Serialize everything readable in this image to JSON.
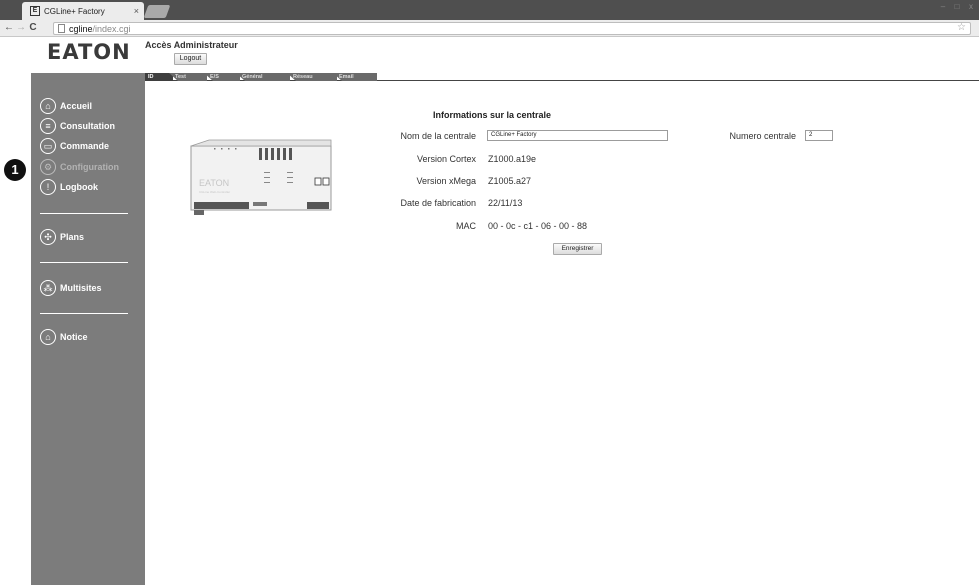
{
  "browser": {
    "tab_title": "CGLine+ Factory",
    "tab_close": "×",
    "url_host": "cgline",
    "url_path": "/index.cgi",
    "back_glyph": "←",
    "forward_glyph": "→",
    "reload_glyph": "C",
    "star_glyph": "☆",
    "minimize_glyph": "–",
    "maximize_glyph": "□",
    "close_glyph": "x"
  },
  "header": {
    "logo": "EATON",
    "admin_title": "Accès Administrateur",
    "logout_label": "Logout"
  },
  "subtabs": [
    {
      "label": "ID",
      "active": true
    },
    {
      "label": "Test"
    },
    {
      "label": "E/S"
    },
    {
      "label": "Général"
    },
    {
      "label": "Réseau"
    },
    {
      "label": "Email"
    }
  ],
  "sidebar": {
    "items": [
      {
        "label": "Accueil",
        "icon": "home-icon",
        "glyph": "⌂"
      },
      {
        "label": "Consultation",
        "icon": "list-icon",
        "glyph": "≡"
      },
      {
        "label": "Commande",
        "icon": "command-icon",
        "glyph": "▭"
      },
      {
        "label": "Configuration",
        "icon": "gears-icon",
        "glyph": "⚙",
        "disabled": true
      },
      {
        "label": "Logbook",
        "icon": "warning-icon",
        "glyph": "!"
      },
      {
        "label": "Plans",
        "icon": "plans-icon",
        "glyph": "✣"
      },
      {
        "label": "Multisites",
        "icon": "multisites-icon",
        "glyph": "⁂"
      },
      {
        "label": "Notice",
        "icon": "notice-icon",
        "glyph": "⌂"
      }
    ]
  },
  "callout": "1",
  "device": {
    "brand": "EATON",
    "subtitle": "CGLine Web-Controller"
  },
  "info": {
    "title": "Informations sur la centrale",
    "name_label": "Nom de la centrale",
    "name_value": "CGLine+ Factory",
    "number_label": "Numero centrale",
    "number_value": "2",
    "cortex_label": "Version Cortex",
    "cortex_value": "Z1000.a19e",
    "xmega_label": "Version xMega",
    "xmega_value": "Z1005.a27",
    "date_label": "Date de fabrication",
    "date_value": "22/11/13",
    "mac_label": "MAC",
    "mac_value": "00 - 0c - c1 - 06 - 00 - 88",
    "save_label": "Enregistrer"
  }
}
